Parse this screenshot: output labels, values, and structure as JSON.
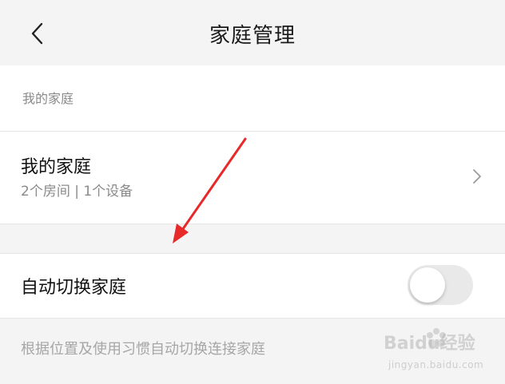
{
  "header": {
    "title": "家庭管理",
    "back_icon": "chevron-left-icon"
  },
  "my_homes_section": {
    "label": "我的家庭",
    "home": {
      "name": "我的家庭",
      "details": "2个房间 | 1个设备",
      "chevron_icon": "chevron-right-icon"
    }
  },
  "auto_switch": {
    "label": "自动切换家庭",
    "enabled": false,
    "description": "根据位置及使用习惯自动切换连接家庭"
  },
  "annotation": {
    "arrow_color": "#e8292a"
  },
  "watermark": {
    "brand": "Baidu经验",
    "url": "jingyan.baidu.com"
  },
  "colors": {
    "background": "#f4f4f4",
    "card": "#ffffff",
    "toggle_off": "#e9e9e9"
  }
}
